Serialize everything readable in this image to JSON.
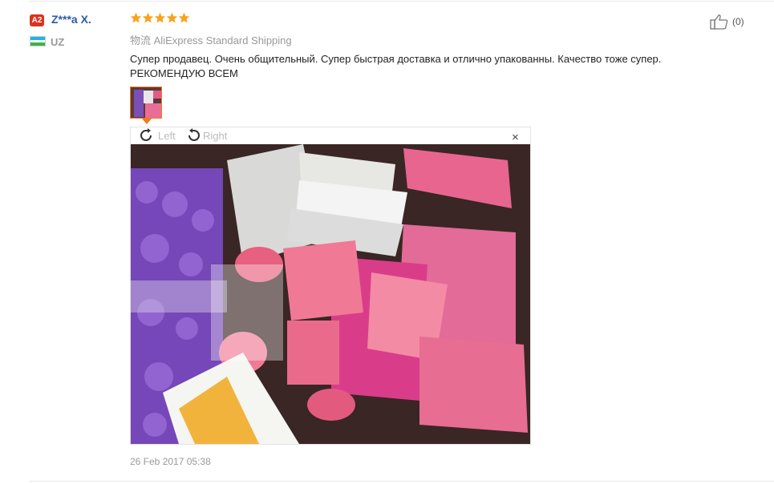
{
  "review": {
    "user": {
      "level_badge": "A2",
      "name": "Z***a X.",
      "country": "UZ"
    },
    "rating": 5,
    "shipping": {
      "label": "物流",
      "method": "AliExpress Standard Shipping"
    },
    "text": "Супер продавец. Очень общительный. Супер быстрая доставка и отлично упакованны. Качество тоже супер. РЕКОМЕНДУЮ ВСЕМ",
    "viewer": {
      "rotate_left": "Left",
      "rotate_right": "Right",
      "close": "×"
    },
    "date": "26 Feb 2017 05:38",
    "helpful": {
      "count_text": "(0)"
    }
  },
  "colors": {
    "star": "#f7a31b",
    "badge": "#d9331d",
    "username": "#2b5aa6",
    "accent_border": "#f07a1c"
  },
  "icons": [
    "star-icon",
    "flag-uz-icon",
    "rotate-left-icon",
    "rotate-right-icon",
    "close-icon",
    "thumbs-up-icon"
  ]
}
